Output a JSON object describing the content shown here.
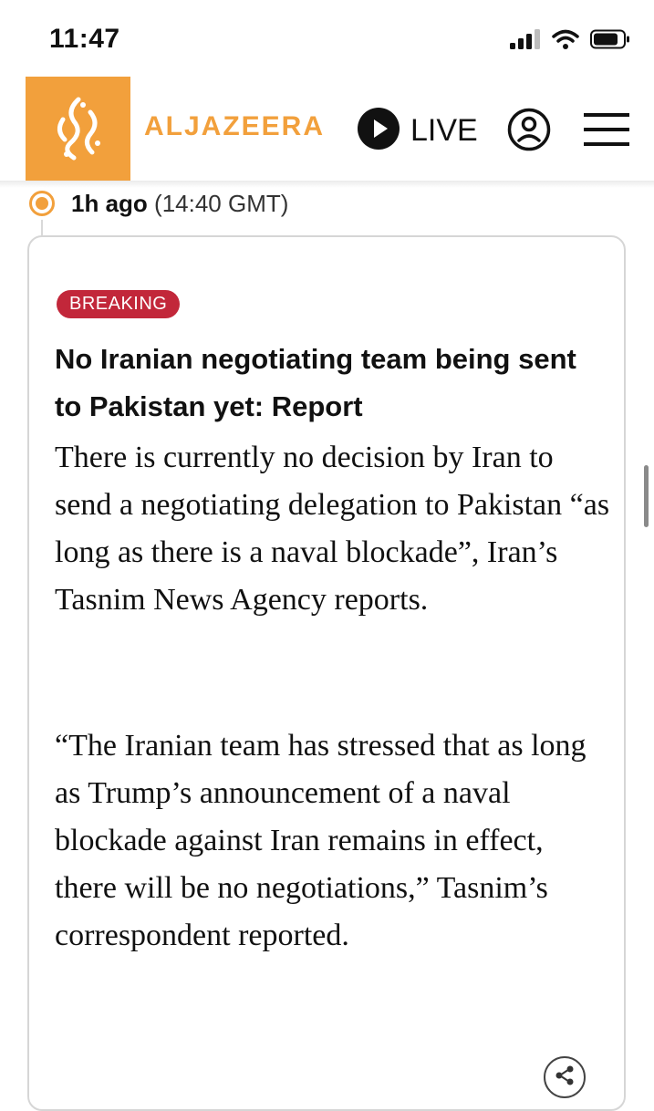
{
  "status_bar": {
    "time": "11:47"
  },
  "header": {
    "brand_name": "ALJAZEERA",
    "live_label": "LIVE",
    "accent_color": "#f2a03c"
  },
  "post": {
    "time_ago": "1h ago",
    "time_gmt": "(14:40 GMT)",
    "badge": "BREAKING",
    "badge_color": "#c2273a",
    "headline": "No Iranian negotiating team being sent to Pakistan yet: Report",
    "paragraphs": [
      "There is currently no decision by Iran to send a negotiating delegation to Pakistan “as long as there is a naval blockade”, Iran’s Tasnim News Agency reports.",
      "“The Iranian team has stressed that as long as Trump’s announcement of a naval blockade against Iran remains in effect, there will be no negotiations,” Tasnim’s correspondent reported."
    ]
  },
  "icons": {
    "signal": "signal-icon",
    "wifi": "wifi-icon",
    "battery": "battery-icon",
    "logo": "aljazeera-logo-icon",
    "live": "play-icon",
    "account": "account-icon",
    "menu": "hamburger-menu-icon",
    "share": "share-icon"
  }
}
